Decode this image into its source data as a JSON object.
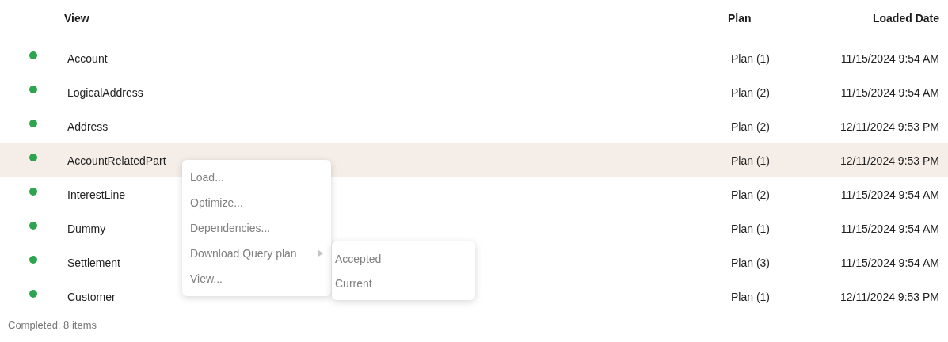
{
  "table": {
    "columns": [
      {
        "label": "View"
      },
      {
        "label": "Plan"
      },
      {
        "label": "Loaded Date"
      }
    ],
    "rows": [
      {
        "name": "Account",
        "plan": "Plan (1)",
        "loaded": "11/15/2024 9:54 AM",
        "color": "#2ea44f",
        "selected": false
      },
      {
        "name": "LogicalAddress",
        "plan": "Plan (2)",
        "loaded": "11/15/2024 9:54 AM",
        "color": "#2ea44f",
        "selected": false
      },
      {
        "name": "Address",
        "plan": "Plan (2)",
        "loaded": "12/11/2024 9:53 PM",
        "color": "#2ea44f",
        "selected": false
      },
      {
        "name": "AccountRelatedPart",
        "plan": "Plan (1)",
        "loaded": "12/11/2024 9:53 PM",
        "color": "#2ea44f",
        "selected": true
      },
      {
        "name": "InterestLine",
        "plan": "Plan (2)",
        "loaded": "11/15/2024 9:54 AM",
        "color": "#2ea44f",
        "selected": false
      },
      {
        "name": "Dummy",
        "plan": "Plan (1)",
        "loaded": "11/15/2024 9:54 AM",
        "color": "#2ea44f",
        "selected": false
      },
      {
        "name": "Settlement",
        "plan": "Plan (3)",
        "loaded": "11/15/2024 9:54 AM",
        "color": "#2ea44f",
        "selected": false
      },
      {
        "name": "Customer",
        "plan": "Plan (1)",
        "loaded": "12/11/2024 9:53 PM",
        "color": "#2ea44f",
        "selected": false
      }
    ]
  },
  "context_menu": {
    "items": [
      {
        "label": "Load...",
        "disabled": true
      },
      {
        "label": "Optimize...",
        "disabled": true
      },
      {
        "label": "Dependencies...",
        "disabled": true
      },
      {
        "label": "Download Query plan",
        "disabled": true,
        "submenu": {
          "items": [
            {
              "label": "Accepted",
              "disabled": true
            },
            {
              "label": "Current",
              "disabled": true
            }
          ]
        }
      },
      {
        "label": "View...",
        "disabled": true
      }
    ]
  },
  "status_bar": {
    "text": "Completed: 8 items"
  }
}
